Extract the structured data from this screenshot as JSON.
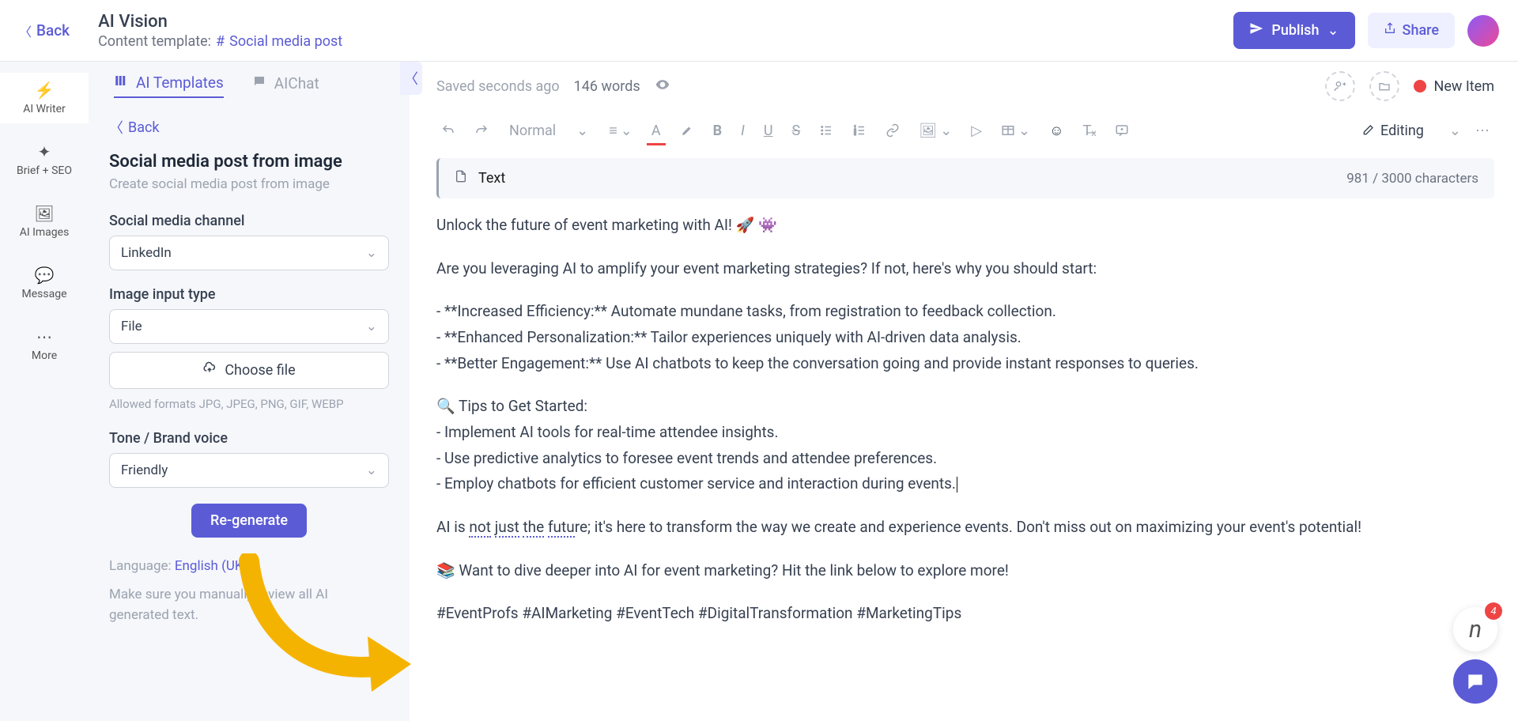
{
  "header": {
    "back_label": "Back",
    "title": "AI Vision",
    "template_prefix": "Content template:",
    "template_link": "Social media post",
    "publish_label": "Publish",
    "share_label": "Share"
  },
  "left_nav": {
    "items": [
      {
        "icon": "bolt-icon",
        "label": "AI Writer"
      },
      {
        "icon": "target-icon",
        "label": "Brief + SEO"
      },
      {
        "icon": "image-icon",
        "label": "AI Images"
      },
      {
        "icon": "message-icon",
        "label": "Message"
      },
      {
        "icon": "more-icon",
        "label": "More"
      }
    ]
  },
  "templates_panel": {
    "tabs": {
      "templates": "AI Templates",
      "chat": "AIChat"
    },
    "back_label": "Back",
    "form_title": "Social media post from image",
    "form_subtitle": "Create social media post from image",
    "fields": {
      "channel_label": "Social media channel",
      "channel_value": "LinkedIn",
      "input_type_label": "Image input type",
      "input_type_value": "File",
      "choose_file_label": "Choose file",
      "allowed": "Allowed formats JPG, JPEG, PNG, GIF, WEBP",
      "tone_label": "Tone / Brand voice",
      "tone_value": "Friendly"
    },
    "regenerate_label": "Re-generate",
    "language_prefix": "Language:",
    "language_value": "English (UK)",
    "warning": "Make sure you manually review all AI generated text."
  },
  "editor": {
    "status": "Saved seconds ago",
    "word_count": "146 words",
    "new_item_label": "New Item",
    "paragraph_style": "Normal",
    "mode_label": "Editing",
    "block_label": "Text",
    "char_count": "981 / 3000 characters",
    "content": {
      "lines": [
        "Unlock the future of event marketing with AI! 🚀 👾",
        "",
        "Are you leveraging AI to amplify your event marketing strategies? If not, here's why you should start:",
        "",
        "- **Increased Efficiency:** Automate mundane tasks, from registration to feedback collection.",
        "- **Enhanced Personalization:** Tailor experiences uniquely with AI-driven data analysis.",
        "- **Better Engagement:** Use AI chatbots to keep the conversation going and provide instant responses to queries.",
        "",
        "🔍 Tips to Get Started:",
        "- Implement AI tools for real-time attendee insights.",
        "- Use predictive analytics to foresee event trends and attendee preferences.",
        "- Employ chatbots for efficient customer service and interaction during events.",
        "",
        "AI is not just the future; it's here to transform the way we create and experience events. Don't miss out on maximizing your event's potential!",
        "",
        "📚 Want to dive deeper into AI for event marketing? Hit the link below to explore more!",
        "",
        "#EventProfs #AIMarketing #EventTech #DigitalTransformation #MarketingTips"
      ]
    }
  },
  "help": {
    "badge_count": "4"
  }
}
